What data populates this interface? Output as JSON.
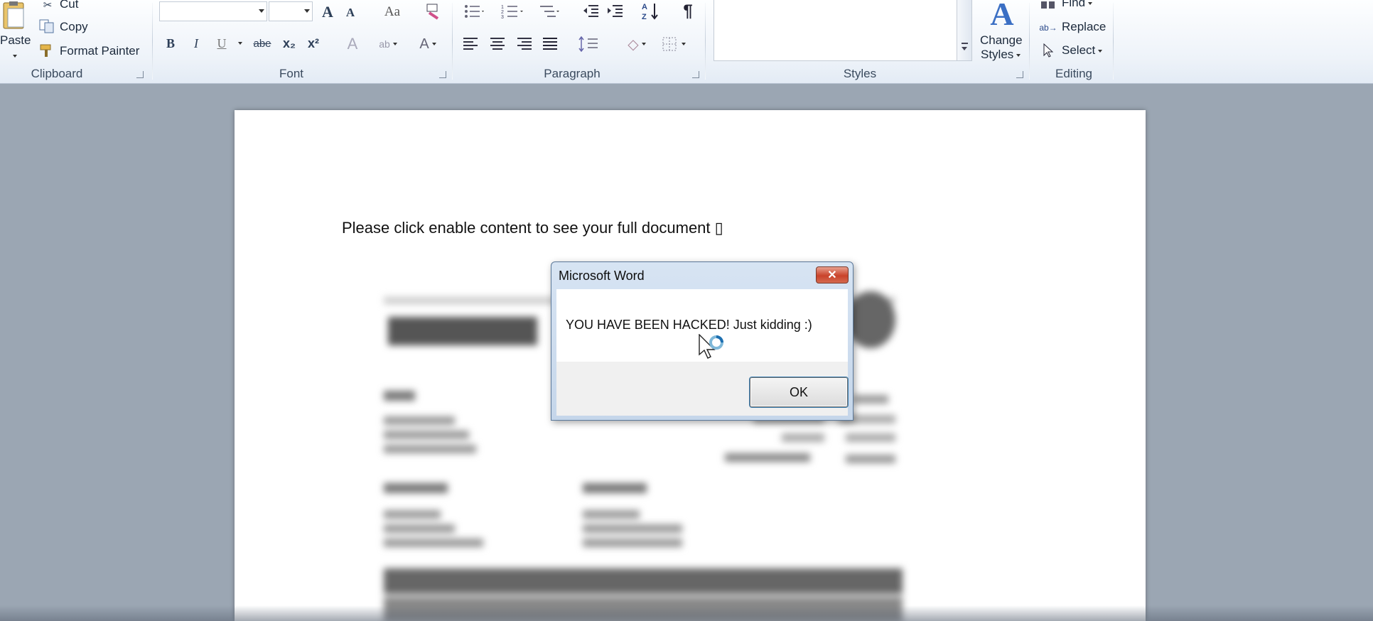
{
  "ribbon": {
    "clipboard": {
      "paste": "Paste",
      "cut": "Cut",
      "copy": "Copy",
      "format_painter": "Format Painter",
      "label": "Clipboard"
    },
    "font": {
      "label": "Font",
      "bold": "B",
      "italic": "I",
      "underline": "U",
      "strike": "abe",
      "subscript": "x₂",
      "superscript": "x²",
      "grow": "A",
      "shrink": "A",
      "change_case": "Aa",
      "font_color": "A"
    },
    "paragraph": {
      "label": "Paragraph",
      "show_marks": "¶"
    },
    "styles": {
      "label": "Styles",
      "change_styles_line1": "Change",
      "change_styles_line2": "Styles"
    },
    "editing": {
      "label": "Editing",
      "find": "Find",
      "replace": "Replace",
      "select": "Select"
    }
  },
  "document": {
    "text": "Please click enable content to see your full document ▯"
  },
  "dialog": {
    "title": "Microsoft Word",
    "close": "✕",
    "message": "YOU HAVE BEEN HACKED! Just kidding :)",
    "ok_label": "OK"
  },
  "colors": {
    "ribbon_bg": "#eef3f9",
    "workspace_bg": "#9ba6b3",
    "close_red": "#c9432b"
  }
}
